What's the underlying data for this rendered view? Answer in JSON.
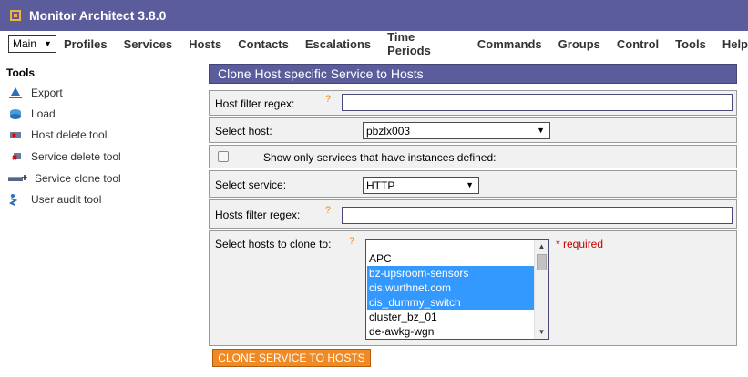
{
  "app": {
    "title": "Monitor Architect 3.8.0"
  },
  "menu": {
    "main_select": "Main",
    "items": [
      "Profiles",
      "Services",
      "Hosts",
      "Contacts",
      "Escalations",
      "Time Periods",
      "Commands",
      "Groups",
      "Control",
      "Tools",
      "Help"
    ]
  },
  "sidebar": {
    "heading": "Tools",
    "tools": [
      "Export",
      "Load",
      "Host delete tool",
      "Service delete tool",
      "Service clone tool",
      "User audit tool"
    ]
  },
  "panel": {
    "title": "Clone Host specific Service to Hosts",
    "host_filter_label": "Host filter regex:",
    "host_filter_value": "",
    "select_host_label": "Select host:",
    "select_host_value": "pbzlx003",
    "show_only_label": "Show only services that have instances defined:",
    "select_service_label": "Select service:",
    "select_service_value": "HTTP",
    "hosts_filter_label": "Hosts filter regex:",
    "hosts_filter_value": "",
    "clone_to_label": "Select hosts to clone to:",
    "required_text": "* required",
    "help_mark": "?",
    "hosts": [
      {
        "name": "APC",
        "selected": false
      },
      {
        "name": "bz-upsroom-sensors",
        "selected": true
      },
      {
        "name": "cis.wurthnet.com",
        "selected": true
      },
      {
        "name": "cis_dummy_switch",
        "selected": true
      },
      {
        "name": "cluster_bz_01",
        "selected": false
      },
      {
        "name": "de-awkg-wgn",
        "selected": false
      }
    ],
    "button_label": "CLONE SERVICE TO HOSTS"
  },
  "colors": {
    "header": "#5a5c9c",
    "button": "#f08a24",
    "selection": "#3399ff",
    "help": "#ef8d1c",
    "required": "#c00000"
  }
}
